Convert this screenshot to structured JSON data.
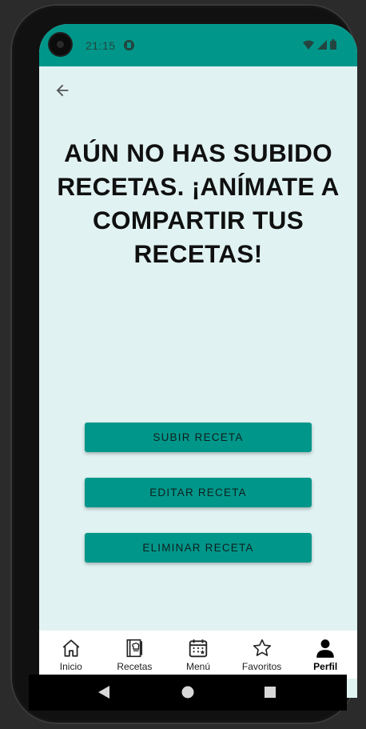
{
  "status_bar": {
    "time": "21:15",
    "icons": [
      "app-notification-icon",
      "wifi-icon",
      "signal-icon",
      "battery-icon"
    ]
  },
  "app_bar": {
    "back_icon": "arrow-back-icon"
  },
  "main": {
    "empty_message": "AÚN NO HAS SUBIDO RECETAS. ¡ANÍMATE A COMPARTIR TUS RECETAS!",
    "buttons": {
      "upload": "SUBIR RECETA",
      "edit": "EDITAR RECETA",
      "delete": "ELIMINAR RECETA"
    }
  },
  "bottom_nav": {
    "items": [
      {
        "label": "Inicio",
        "icon": "home-icon",
        "active": false
      },
      {
        "label": "Recetas",
        "icon": "recipe-book-icon",
        "active": false
      },
      {
        "label": "Menú",
        "icon": "calendar-icon",
        "active": false
      },
      {
        "label": "Favoritos",
        "icon": "star-icon",
        "active": false
      },
      {
        "label": "Perfil",
        "icon": "person-icon",
        "active": true
      }
    ]
  },
  "system_nav": {
    "icons": [
      "back-triangle-icon",
      "home-circle-icon",
      "recents-square-icon"
    ]
  },
  "colors": {
    "primary": "#00978a",
    "background": "#e1f2f2",
    "text": "#101010"
  }
}
